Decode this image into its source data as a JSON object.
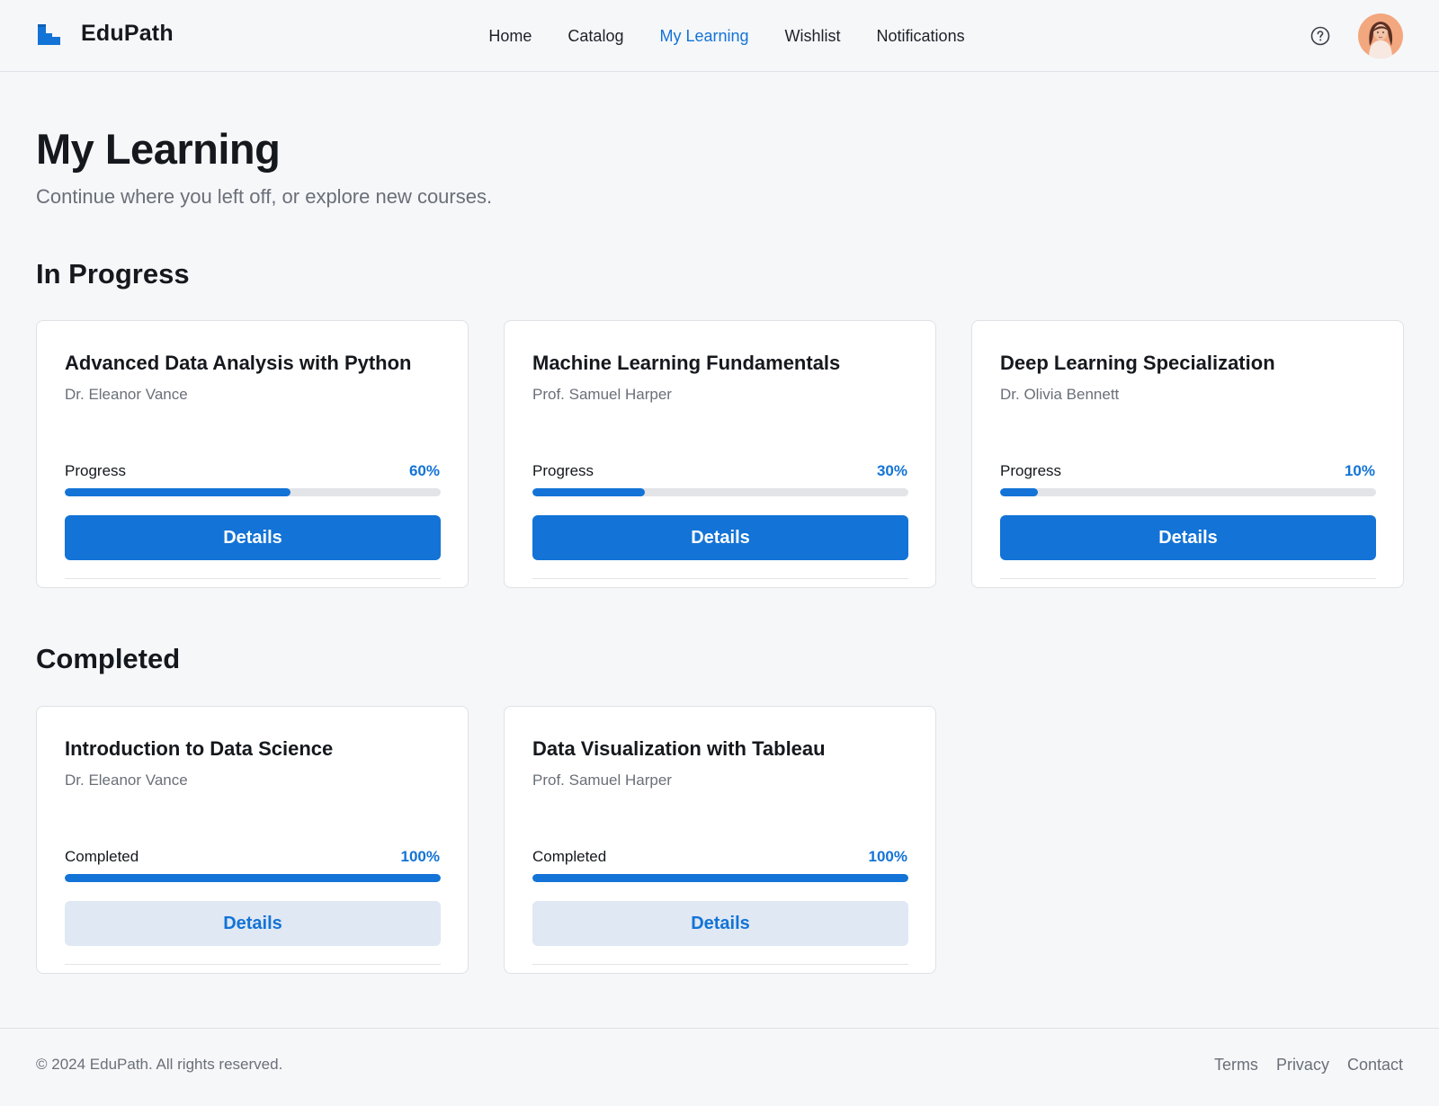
{
  "brand": {
    "name": "EduPath",
    "logo_icon": "edupath-logo-icon",
    "accent_color": "#1373d6"
  },
  "nav": {
    "items": [
      {
        "label": "Home",
        "active": false
      },
      {
        "label": "Catalog",
        "active": false
      },
      {
        "label": "My Learning",
        "active": true
      },
      {
        "label": "Wishlist",
        "active": false
      },
      {
        "label": "Notifications",
        "active": false
      }
    ]
  },
  "header_actions": {
    "help_icon": "help-circle-icon",
    "avatar": "user-avatar"
  },
  "page": {
    "title": "My Learning",
    "subtitle": "Continue where you left off, or explore new courses."
  },
  "in_progress": {
    "title": "In Progress",
    "courses": [
      {
        "title": "Advanced Data Analysis with Python",
        "instructor": "Dr. Eleanor Vance",
        "status_label": "Progress",
        "progress_text": "60%",
        "progress": 60,
        "button_label": "Details"
      },
      {
        "title": "Machine Learning Fundamentals",
        "instructor": "Prof. Samuel Harper",
        "status_label": "Progress",
        "progress_text": "30%",
        "progress": 30,
        "button_label": "Details"
      },
      {
        "title": "Deep Learning Specialization",
        "instructor": "Dr. Olivia Bennett",
        "status_label": "Progress",
        "progress_text": "10%",
        "progress": 10,
        "button_label": "Details"
      }
    ]
  },
  "completed": {
    "title": "Completed",
    "courses": [
      {
        "title": "Introduction to Data Science",
        "instructor": "Dr. Eleanor Vance",
        "status_label": "Completed",
        "progress_text": "100%",
        "progress": 100,
        "button_label": "Details"
      },
      {
        "title": "Data Visualization with Tableau",
        "instructor": "Prof. Samuel Harper",
        "status_label": "Completed",
        "progress_text": "100%",
        "progress": 100,
        "button_label": "Details"
      }
    ]
  },
  "footer": {
    "copyright": "© 2024 EduPath. All rights reserved.",
    "links": [
      "Terms",
      "Privacy",
      "Contact"
    ]
  }
}
